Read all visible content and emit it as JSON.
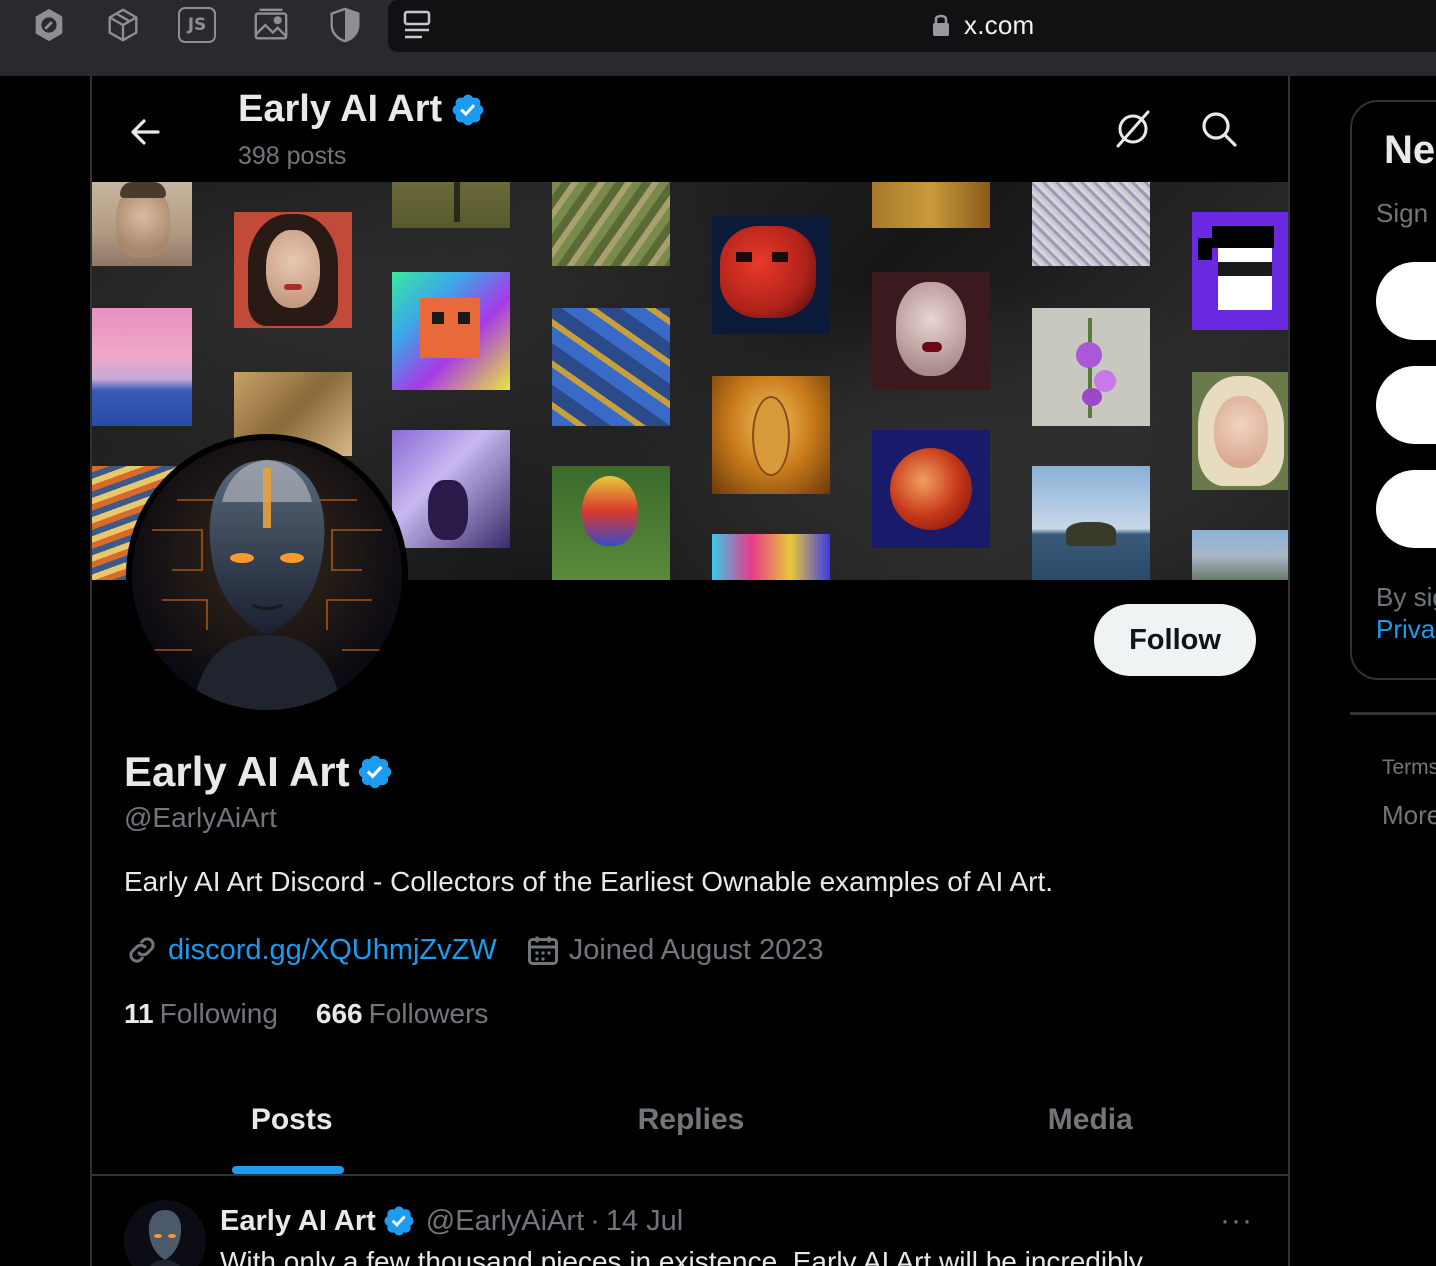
{
  "browser": {
    "url": "x.com",
    "extensions": [
      "wrench-extension-icon",
      "cube-extension-icon",
      "JS",
      "image-extension-icon",
      "shield-extension-icon"
    ]
  },
  "header": {
    "title": "Early AI Art",
    "posts_count": "398 posts"
  },
  "profile": {
    "name": "Early AI Art",
    "handle": "@EarlyAiArt",
    "bio": "Early AI Art Discord - Collectors of the Earliest Ownable examples of AI Art.",
    "link": "discord.gg/XQUhmjZvZW",
    "joined": "Joined August 2023",
    "following_count": "11",
    "following_label": "Following",
    "followers_count": "666",
    "followers_label": "Followers",
    "follow_label": "Follow"
  },
  "tabs": [
    {
      "label": "Posts",
      "active": true
    },
    {
      "label": "Replies",
      "active": false
    },
    {
      "label": "Media",
      "active": false
    }
  ],
  "post": {
    "name": "Early AI Art",
    "handle": "@EarlyAiArt",
    "separator": "·",
    "date": "14 Jul",
    "more": "···",
    "text": "With only a few thousand pieces in existence, Early AI Art will be incredibly"
  },
  "sidebar": {
    "title": "Ne",
    "subtitle": "Sign",
    "terms_text": "By sig",
    "privacy_text": "Priva",
    "footer_terms": "Terms",
    "footer_more": "More"
  },
  "colors": {
    "accent": "#1d9bf0",
    "background": "#000000",
    "muted_text": "#71767b",
    "follow_button": "#eff3f4"
  }
}
